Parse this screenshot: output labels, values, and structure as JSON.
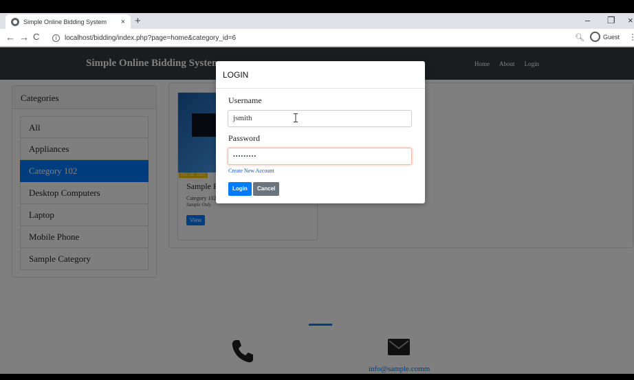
{
  "browser": {
    "tab_title": "Simple Online Bidding System",
    "tab_close": "×",
    "new_tab": "+",
    "url": "localhost/bidding/index.php?page=home&category_id=6",
    "profile": "Guest",
    "minimize": "–",
    "restore": "❐",
    "close": "×"
  },
  "site": {
    "brand": "Simple Online Bidding System",
    "nav": [
      "Home",
      "About",
      "Login"
    ]
  },
  "categories": {
    "header": "Categories",
    "items": [
      "All",
      "Appliances",
      "Category 102",
      "Desktop Computers",
      "Laptop",
      "Mobile Phone",
      "Sample Category"
    ],
    "active": "Category 102"
  },
  "product": {
    "date_badge": "Nov 28, 2020",
    "name": "Sample P",
    "category": "Category 102",
    "description": "Sample Only",
    "view_label": "View"
  },
  "footer": {
    "email": "info@sample.comm"
  },
  "modal": {
    "title": "LOGIN",
    "username_label": "Username",
    "username_value": "jsmith",
    "password_label": "Password",
    "password_value": "•••••••••",
    "create_account": "Create New Account",
    "login_button": "Login",
    "cancel_button": "Cancel"
  }
}
